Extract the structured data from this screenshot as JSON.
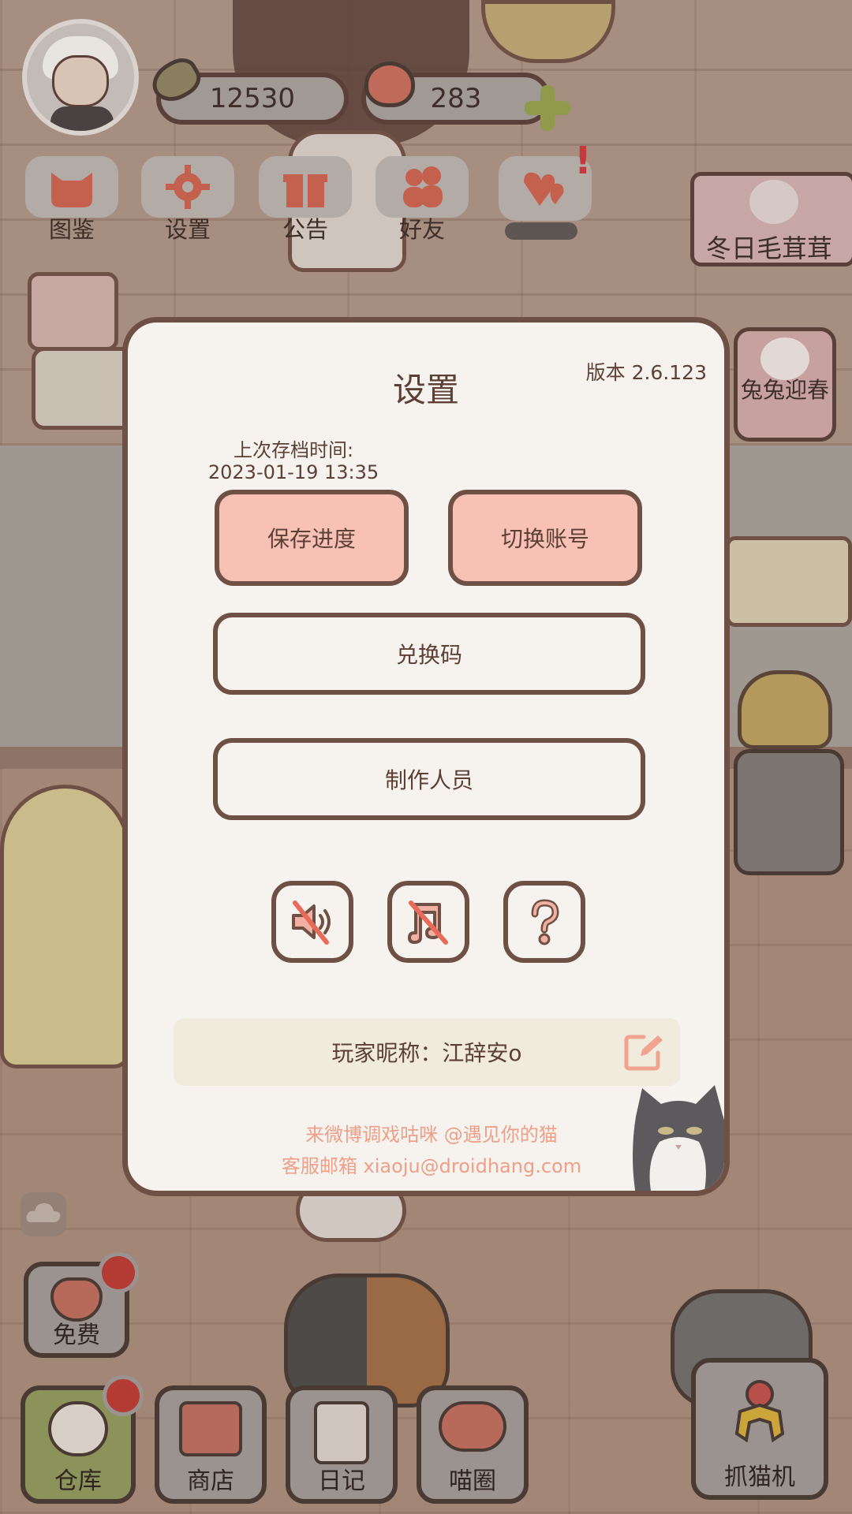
{
  "hud": {
    "fish_count": "12530",
    "heart_count": "283"
  },
  "menu": [
    {
      "label": "图鉴"
    },
    {
      "label": "设置"
    },
    {
      "label": "公告"
    },
    {
      "label": "好友"
    }
  ],
  "event_banner": {
    "label": "冬日毛茸茸"
  },
  "bunny_event": {
    "label": "兔兔迎春"
  },
  "settings_modal": {
    "title": "设置",
    "version": "版本 2.6.123",
    "save_time_label": "上次存档时间:",
    "save_time_value": "2023-01-19 13:35",
    "save_button": "保存进度",
    "switch_account_button": "切换账号",
    "redeem_code_button": "兑换码",
    "credits_button": "制作人员",
    "nickname": "玩家昵称：江辞安o",
    "weibo_text": "来微博调戏咕咪 @遇见你的猫",
    "email_text": "客服邮箱 xiaoju@droidhang.com"
  },
  "bottom_bar": {
    "free_label": "免费",
    "warehouse_label": "仓库",
    "shop_label": "商店",
    "diary_label": "日记",
    "circle_label": "喵圈",
    "claw_label": "抓猫机"
  },
  "colors": {
    "modal_bg": "#f6f3ef",
    "modal_border": "#6e5044",
    "pink_button": "#f7c1b6",
    "link_color": "#ee9f88"
  }
}
